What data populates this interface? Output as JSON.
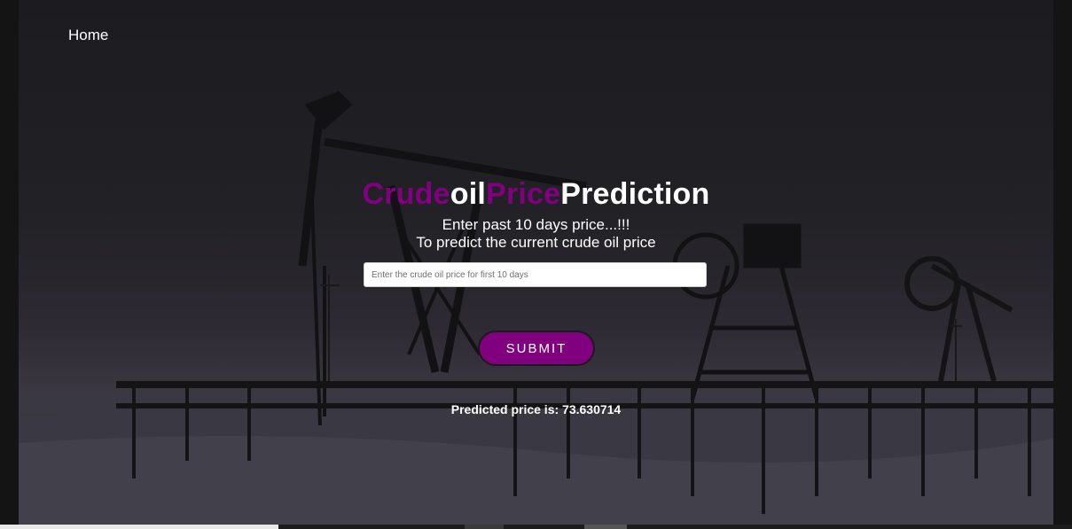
{
  "nav": {
    "home_label": "Home"
  },
  "hero": {
    "title_parts": [
      "Crude",
      "oil",
      "Price",
      "Prediction"
    ],
    "subtitle_line1": "Enter past 10 days price...!!!",
    "subtitle_line2": "To predict the current crude oil price"
  },
  "form": {
    "input_placeholder": "Enter the crude oil price for first 10 days",
    "input_value": "",
    "submit_label": "SUBMIT"
  },
  "result": {
    "text": "Predicted price is: 73.630714"
  },
  "colors": {
    "accent": "#800080",
    "text": "#ffffff",
    "background": "#2a2a2f"
  }
}
